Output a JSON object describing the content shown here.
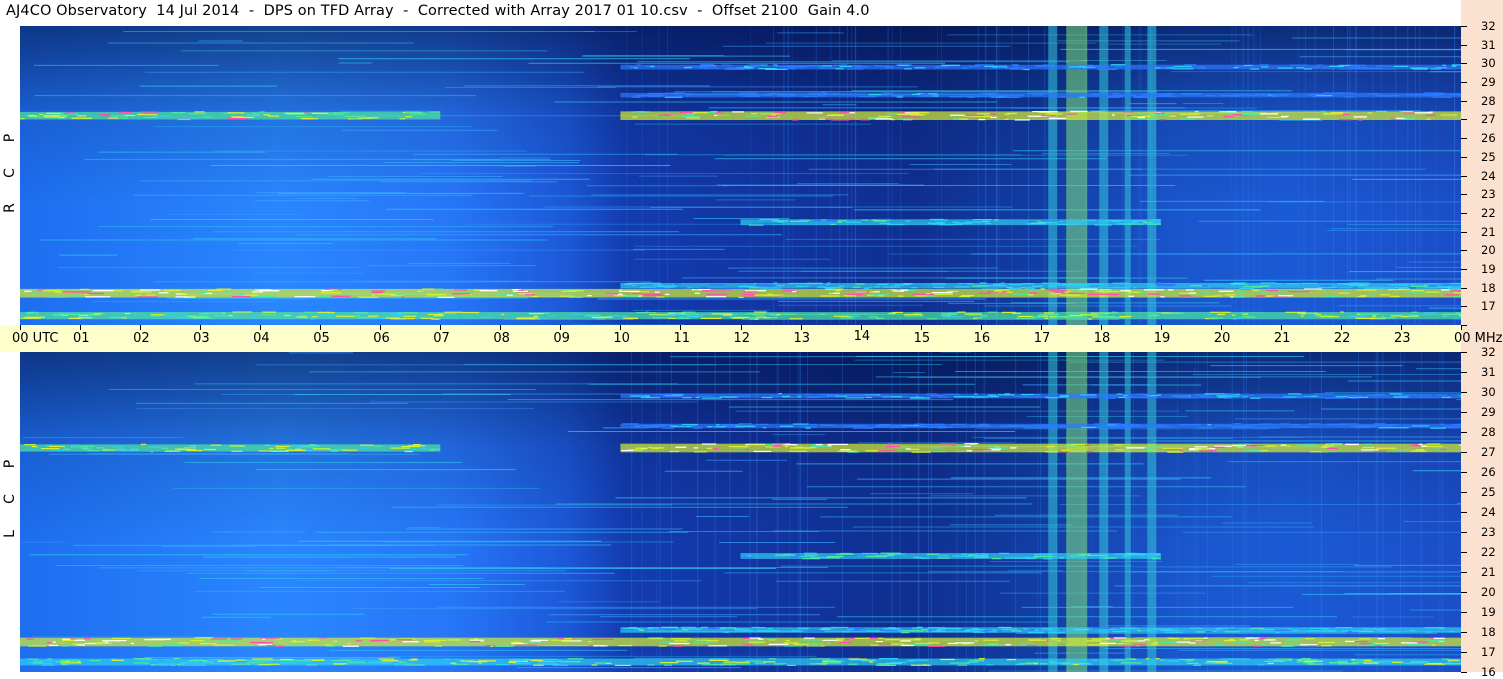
{
  "title": "AJ4CO Observatory  14 Jul 2014  -  DPS on TFD Array  -  Corrected with Array 2017 01 10.csv  -  Offset 2100  Gain 4.0",
  "time_axis": {
    "labels": [
      "00 UTC",
      "01",
      "02",
      "03",
      "04",
      "05",
      "06",
      "07",
      "08",
      "09",
      "10",
      "11",
      "12",
      "13",
      "14",
      "15",
      "16",
      "17",
      "18",
      "19",
      "20",
      "21",
      "22",
      "23",
      "00 MHz"
    ]
  },
  "freq_axis": {
    "labels": [
      "32",
      "31",
      "30",
      "29",
      "28",
      "27",
      "26",
      "25",
      "24",
      "23",
      "22",
      "21",
      "20",
      "19",
      "18",
      "17",
      "16"
    ]
  },
  "panels": [
    {
      "id": "rcp",
      "letters": [
        "P",
        "C",
        "R"
      ]
    },
    {
      "id": "lcp",
      "letters": [
        "P",
        "C",
        "L"
      ]
    }
  ],
  "colors": {
    "background_dark": "#0a1a6e",
    "background_mid": "#1f5be0",
    "background_light": "#2f8fff",
    "axis_bg": "#ffffcc",
    "right_strip": "#fbe1cf"
  },
  "chart_data": [
    {
      "type": "heatmap",
      "title": "AJ4CO Observatory  14 Jul 2014  -  DPS on TFD Array  -  Corrected with Array 2017 01 10.csv  -  Offset 2100  Gain 4.0",
      "panel": "R C P",
      "x_ticks": [
        "00 UTC",
        "01",
        "02",
        "03",
        "04",
        "05",
        "06",
        "07",
        "08",
        "09",
        "10",
        "11",
        "12",
        "13",
        "14",
        "15",
        "16",
        "17",
        "18",
        "19",
        "20",
        "21",
        "22",
        "23",
        "00 MHz"
      ],
      "xlim": [
        0,
        24
      ],
      "y_ticks": [
        32,
        31,
        30,
        29,
        28,
        27,
        26,
        25,
        24,
        23,
        22,
        21,
        20,
        19,
        18,
        17,
        16
      ],
      "ylim": [
        16,
        32
      ],
      "bands": [
        {
          "freq": 27.2,
          "start": 0,
          "end": 7,
          "level": 0.8
        },
        {
          "freq": 27.2,
          "start": 10,
          "end": 24,
          "level": 0.95
        },
        {
          "freq": 17.7,
          "start": 0,
          "end": 24,
          "level": 0.95
        },
        {
          "freq": 16.5,
          "start": 0,
          "end": 24,
          "level": 0.75
        },
        {
          "freq": 18.1,
          "start": 10,
          "end": 24,
          "level": 0.5
        },
        {
          "freq": 21.5,
          "start": 12,
          "end": 19,
          "level": 0.55
        },
        {
          "freq": 29.8,
          "start": 10,
          "end": 24,
          "level": 0.4
        },
        {
          "freq": 28.3,
          "start": 10,
          "end": 24,
          "level": 0.35
        }
      ],
      "broadband": [
        {
          "time": 17.2,
          "width": 0.15,
          "level": 0.45
        },
        {
          "time": 17.6,
          "width": 0.35,
          "level": 0.6
        },
        {
          "time": 18.05,
          "width": 0.15,
          "level": 0.45
        },
        {
          "time": 18.45,
          "width": 0.1,
          "level": 0.35
        },
        {
          "time": 18.85,
          "width": 0.15,
          "level": 0.5
        }
      ]
    },
    {
      "type": "heatmap",
      "panel": "L C P",
      "x_ticks": [
        "00 UTC",
        "01",
        "02",
        "03",
        "04",
        "05",
        "06",
        "07",
        "08",
        "09",
        "10",
        "11",
        "12",
        "13",
        "14",
        "15",
        "16",
        "17",
        "18",
        "19",
        "20",
        "21",
        "22",
        "23",
        "00 MHz"
      ],
      "xlim": [
        0,
        24
      ],
      "y_ticks": [
        32,
        31,
        30,
        29,
        28,
        27,
        26,
        25,
        24,
        23,
        22,
        21,
        20,
        19,
        18,
        17,
        16
      ],
      "ylim": [
        16,
        32
      ],
      "bands": [
        {
          "freq": 27.2,
          "start": 0,
          "end": 7,
          "level": 0.75
        },
        {
          "freq": 27.2,
          "start": 10,
          "end": 24,
          "level": 0.95
        },
        {
          "freq": 17.5,
          "start": 0,
          "end": 24,
          "level": 0.95
        },
        {
          "freq": 16.5,
          "start": 0,
          "end": 24,
          "level": 0.7
        },
        {
          "freq": 18.1,
          "start": 10,
          "end": 24,
          "level": 0.5
        },
        {
          "freq": 21.8,
          "start": 12,
          "end": 19,
          "level": 0.55
        },
        {
          "freq": 29.8,
          "start": 10,
          "end": 24,
          "level": 0.4
        },
        {
          "freq": 28.3,
          "start": 10,
          "end": 24,
          "level": 0.35
        }
      ],
      "broadband": [
        {
          "time": 17.2,
          "width": 0.15,
          "level": 0.45
        },
        {
          "time": 17.6,
          "width": 0.35,
          "level": 0.6
        },
        {
          "time": 18.05,
          "width": 0.15,
          "level": 0.45
        },
        {
          "time": 18.45,
          "width": 0.1,
          "level": 0.35
        },
        {
          "time": 18.85,
          "width": 0.15,
          "level": 0.5
        }
      ]
    }
  ]
}
